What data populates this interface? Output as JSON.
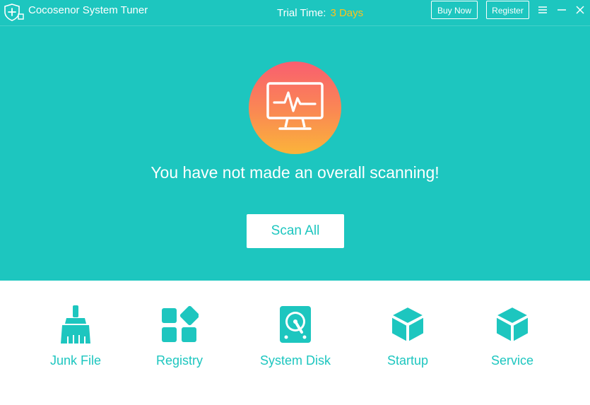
{
  "app": {
    "title": "Cocosenor System Tuner",
    "trial_label": "Trial Time:",
    "trial_value": "3 Days",
    "buy_now": "Buy Now",
    "register": "Register"
  },
  "main": {
    "headline": "You have not made an overall scanning!",
    "scan_button": "Scan All"
  },
  "tools": [
    {
      "label": "Junk File",
      "icon": "broom-icon"
    },
    {
      "label": "Registry",
      "icon": "registry-icon"
    },
    {
      "label": "System Disk",
      "icon": "disk-icon"
    },
    {
      "label": "Startup",
      "icon": "cube-icon"
    },
    {
      "label": "Service",
      "icon": "cube-icon"
    }
  ],
  "colors": {
    "accent": "#1dc6bf",
    "trial_highlight": "#ffc21a",
    "gradient_top": "#f95e70",
    "gradient_bottom": "#fbb43a"
  }
}
